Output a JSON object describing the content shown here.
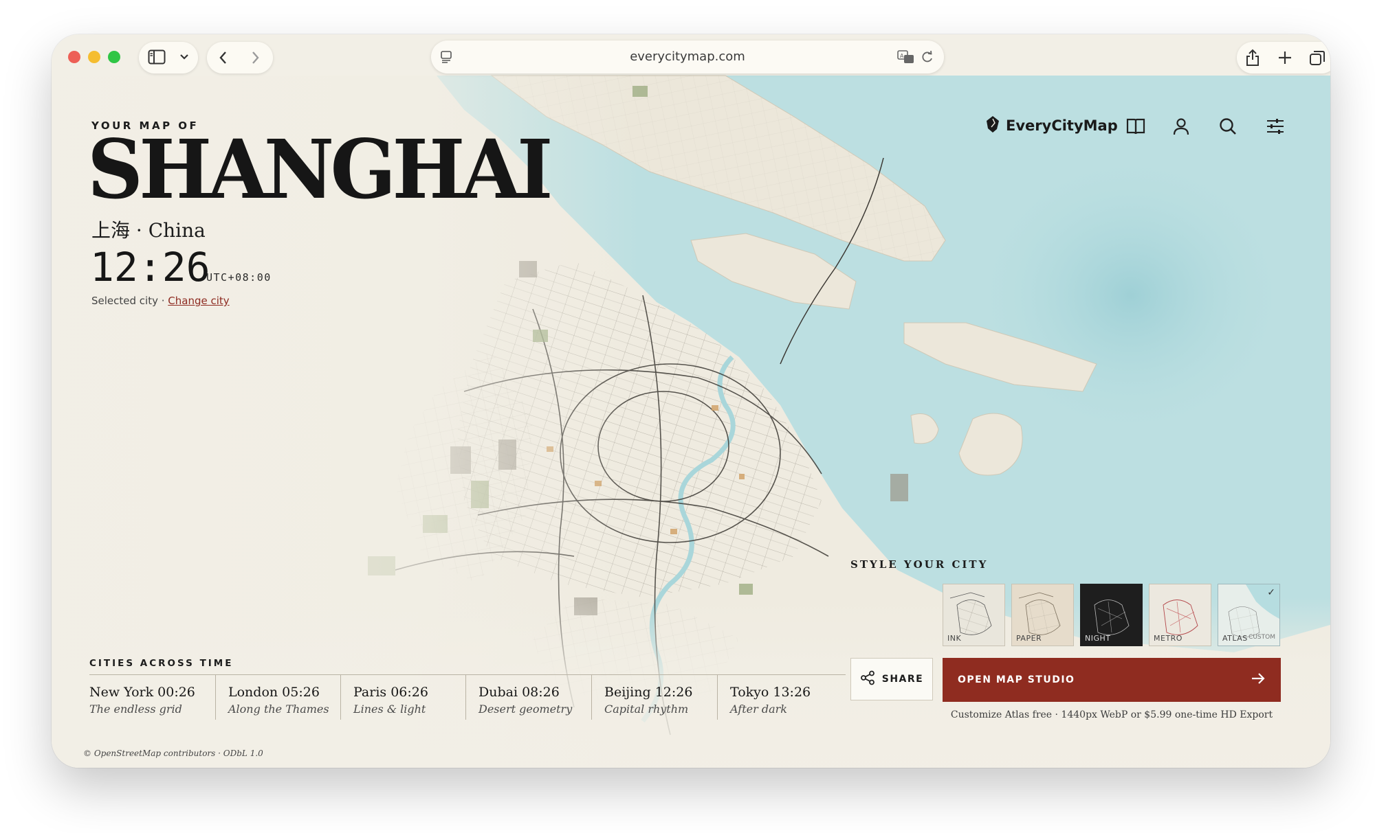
{
  "browser": {
    "url": "everycitymap.com"
  },
  "hero": {
    "eyebrow": "YOUR MAP OF",
    "city": "SHANGHAI",
    "subtitle": "上海 · China",
    "time": "12:26",
    "timezone": "UTC+08:00",
    "selected_prefix": "Selected city · ",
    "change_city": "Change city"
  },
  "nav": {
    "brand": "EveryCityMap",
    "icons": [
      "book-icon",
      "user-icon",
      "search-icon",
      "sliders-icon"
    ]
  },
  "style_panel": {
    "title": "STYLE YOUR CITY",
    "styles": [
      {
        "label": "INK",
        "bg": "#e9e6dc",
        "ink": "#333333"
      },
      {
        "label": "PAPER",
        "bg": "#e6dccb",
        "ink": "#6e6251"
      },
      {
        "label": "NIGHT",
        "bg": "#1e1e1e",
        "ink": "#bdbdbd"
      },
      {
        "label": "METRO",
        "bg": "#ece8df",
        "ink": "#b4474a"
      },
      {
        "label": "ATLAS",
        "extra": "CUSTOM",
        "bg": "#e7eeea",
        "ink": "#555555",
        "selected": true
      }
    ],
    "share_label": "SHARE",
    "studio_label": "OPEN MAP STUDIO",
    "note": "Customize Atlas free · 1440px WebP or $5.99 one-time HD Export"
  },
  "cities_across_time": {
    "title": "CITIES ACROSS TIME",
    "items": [
      {
        "name": "New York 00:26",
        "tagline": "The endless grid"
      },
      {
        "name": "London 05:26",
        "tagline": "Along the Thames"
      },
      {
        "name": "Paris 06:26",
        "tagline": "Lines & light"
      },
      {
        "name": "Dubai 08:26",
        "tagline": "Desert geometry"
      },
      {
        "name": "Beijing 12:26",
        "tagline": "Capital rhythm"
      },
      {
        "name": "Tokyo 13:26",
        "tagline": "After dark"
      }
    ]
  },
  "attribution": "© OpenStreetMap contributors · ODbL 1.0",
  "colors": {
    "background": "#f2efe6",
    "water": "#b6dde0",
    "accent": "#8f2c20",
    "link": "#8e2b21"
  }
}
